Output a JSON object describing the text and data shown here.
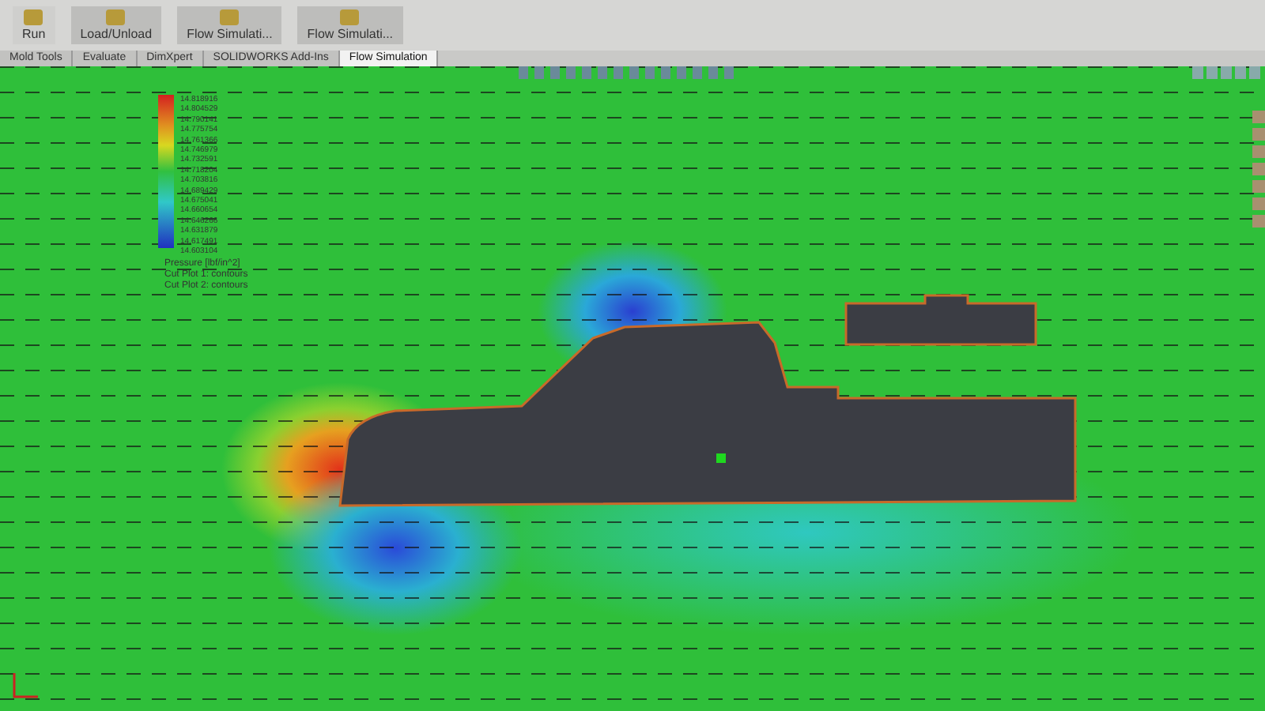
{
  "toolbar": {
    "buttons": [
      {
        "label": "Run",
        "kind": "small"
      },
      {
        "label": "Load/Unload",
        "kind": "large"
      },
      {
        "label": "Flow Simulati...",
        "kind": "large"
      },
      {
        "label": "Flow Simulati...",
        "kind": "large"
      }
    ]
  },
  "tabs": [
    {
      "label": "Mold Tools",
      "selected": false
    },
    {
      "label": "Evaluate",
      "selected": false
    },
    {
      "label": "DimXpert",
      "selected": false
    },
    {
      "label": "SOLIDWORKS Add-Ins",
      "selected": false
    },
    {
      "label": "Flow Simulation",
      "selected": true
    }
  ],
  "legend": {
    "values": [
      "14.818916",
      "14.804529",
      "14.790141",
      "14.775754",
      "14.761366",
      "14.746979",
      "14.732591",
      "14.718204",
      "14.703816",
      "14.689429",
      "14.675041",
      "14.660654",
      "14.646266",
      "14.631879",
      "14.617491",
      "14.603104"
    ],
    "title": "Pressure [lbf/in^2]",
    "plots": [
      "Cut Plot 1: contours",
      "Cut Plot 2: contours"
    ]
  }
}
